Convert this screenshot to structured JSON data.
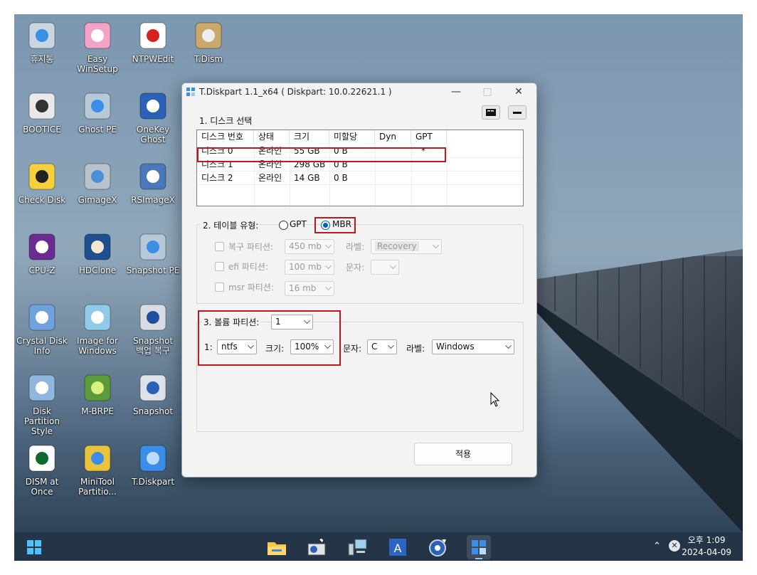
{
  "desktop": {
    "icons": [
      {
        "label": "휴지통",
        "icon": "recycle-bin-icon"
      },
      {
        "label": "Easy\nWinSetup",
        "icon": "windows-logo-icon"
      },
      {
        "label": "NTPWEdit",
        "icon": "nt-key-icon"
      },
      {
        "label": "T.Dism",
        "icon": "disc-box-icon"
      },
      {
        "label": "BOOTICE",
        "icon": "floppy-diamond-icon"
      },
      {
        "label": "Ghost PE",
        "icon": "drive-clock-icon"
      },
      {
        "label": "OneKey\nGhost",
        "icon": "ghost-gear-icon"
      },
      {
        "label": "Check Disk",
        "icon": "warning-drive-icon"
      },
      {
        "label": "GimageX",
        "icon": "drives-arrow-icon"
      },
      {
        "label": "RSImageX",
        "icon": "computer-gear-icon"
      },
      {
        "label": "CPU-Z",
        "icon": "cpu-chip-icon"
      },
      {
        "label": "HDClone",
        "icon": "sheep-icon"
      },
      {
        "label": "Snapshot PE",
        "icon": "drive-clock-icon"
      },
      {
        "label": "Crystal Disk\nInfo",
        "icon": "magnifier-drive-icon"
      },
      {
        "label": "Image for\nWindows",
        "icon": "monitor-image-icon"
      },
      {
        "label": "Snapshot\n백업 복구",
        "icon": "sna-drive-icon"
      },
      {
        "label": "Disk Partition\nStyle",
        "icon": "magnifier-disk-icon"
      },
      {
        "label": "M-BRPE",
        "icon": "green-drive-icon"
      },
      {
        "label": "Snapshot",
        "icon": "snapshot-camera-icon"
      },
      {
        "label": "DISM at\nOnce",
        "icon": "d-letter-icon"
      },
      {
        "label": "MiniTool\nPartitio...",
        "icon": "magic-wand-disk-icon"
      },
      {
        "label": "T.Diskpart",
        "icon": "tiles-icon"
      }
    ]
  },
  "window": {
    "title": "T.Diskpart 1.1_x64 ( Diskpart: 10.0.22621.1 )",
    "section1": "1. 디스크 선택",
    "columns": [
      "디스크 번호",
      "상태",
      "크기",
      "미할당",
      "Dyn",
      "GPT"
    ],
    "rows": [
      [
        "디스크 0",
        "온라인",
        "55 GB",
        "0 B",
        "",
        "*"
      ],
      [
        "디스크 1",
        "온라인",
        "298 GB",
        "0 B",
        "",
        ""
      ],
      [
        "디스크 2",
        "온라인",
        "14 GB",
        "0 B",
        "",
        ""
      ]
    ],
    "section2": "2. 테이블 유형:",
    "gpt_label": "GPT",
    "mbr_label": "MBR",
    "table_type_selected": "MBR",
    "recovery_label": "복구 파티션:",
    "recovery_size": "450 mb",
    "recovery_label_caption": "라벨:",
    "recovery_label_value": "Recovery",
    "efi_label": "efi 파티션:",
    "efi_size": "100 mb",
    "efi_letter_caption": "문자:",
    "efi_letter_value": "",
    "msr_label": "msr 파티션:",
    "msr_size": "16 mb",
    "section3": "3. 볼륨 파티션:",
    "volume_count": "1",
    "vol_index": "1:",
    "fs_value": "ntfs",
    "size_caption": "크기:",
    "size_value": "100%",
    "letter_caption": "문자:",
    "letter_value": "C",
    "label_caption": "라벨:",
    "label_value": "Windows",
    "apply_label": "적용",
    "cmd_button_icon": "console-icon",
    "minus_button_icon": "minus-icon"
  },
  "taskbar": {
    "apps": [
      "start-icon",
      "file-explorer-icon",
      "snapshot-icon",
      "image-for-windows-icon",
      "a-editor-icon",
      "onekey-ghost-icon",
      "t-diskpart-icon"
    ],
    "time": "오후 1:09",
    "date": "2024-04-09"
  }
}
